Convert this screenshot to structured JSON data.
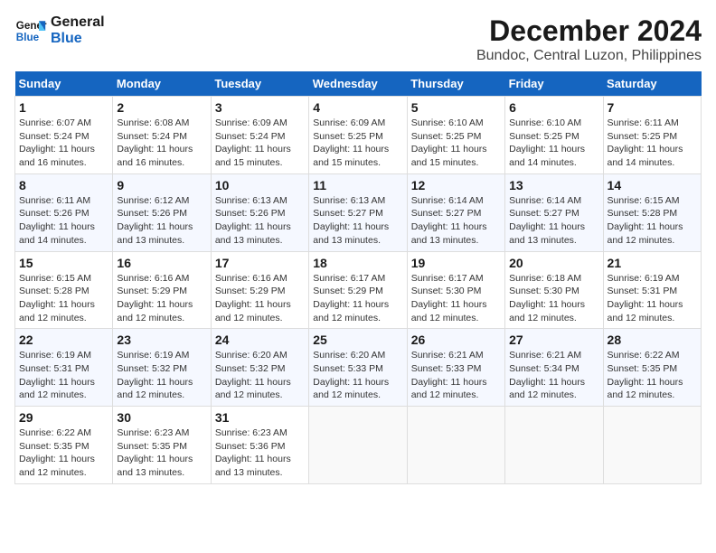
{
  "logo": {
    "line1": "General",
    "line2": "Blue"
  },
  "title": "December 2024",
  "subtitle": "Bundoc, Central Luzon, Philippines",
  "weekdays": [
    "Sunday",
    "Monday",
    "Tuesday",
    "Wednesday",
    "Thursday",
    "Friday",
    "Saturday"
  ],
  "weeks": [
    [
      {
        "day": "1",
        "sunrise": "6:07 AM",
        "sunset": "5:24 PM",
        "daylight": "11 hours and 16 minutes."
      },
      {
        "day": "2",
        "sunrise": "6:08 AM",
        "sunset": "5:24 PM",
        "daylight": "11 hours and 16 minutes."
      },
      {
        "day": "3",
        "sunrise": "6:09 AM",
        "sunset": "5:24 PM",
        "daylight": "11 hours and 15 minutes."
      },
      {
        "day": "4",
        "sunrise": "6:09 AM",
        "sunset": "5:25 PM",
        "daylight": "11 hours and 15 minutes."
      },
      {
        "day": "5",
        "sunrise": "6:10 AM",
        "sunset": "5:25 PM",
        "daylight": "11 hours and 15 minutes."
      },
      {
        "day": "6",
        "sunrise": "6:10 AM",
        "sunset": "5:25 PM",
        "daylight": "11 hours and 14 minutes."
      },
      {
        "day": "7",
        "sunrise": "6:11 AM",
        "sunset": "5:25 PM",
        "daylight": "11 hours and 14 minutes."
      }
    ],
    [
      {
        "day": "8",
        "sunrise": "6:11 AM",
        "sunset": "5:26 PM",
        "daylight": "11 hours and 14 minutes."
      },
      {
        "day": "9",
        "sunrise": "6:12 AM",
        "sunset": "5:26 PM",
        "daylight": "11 hours and 13 minutes."
      },
      {
        "day": "10",
        "sunrise": "6:13 AM",
        "sunset": "5:26 PM",
        "daylight": "11 hours and 13 minutes."
      },
      {
        "day": "11",
        "sunrise": "6:13 AM",
        "sunset": "5:27 PM",
        "daylight": "11 hours and 13 minutes."
      },
      {
        "day": "12",
        "sunrise": "6:14 AM",
        "sunset": "5:27 PM",
        "daylight": "11 hours and 13 minutes."
      },
      {
        "day": "13",
        "sunrise": "6:14 AM",
        "sunset": "5:27 PM",
        "daylight": "11 hours and 13 minutes."
      },
      {
        "day": "14",
        "sunrise": "6:15 AM",
        "sunset": "5:28 PM",
        "daylight": "11 hours and 12 minutes."
      }
    ],
    [
      {
        "day": "15",
        "sunrise": "6:15 AM",
        "sunset": "5:28 PM",
        "daylight": "11 hours and 12 minutes."
      },
      {
        "day": "16",
        "sunrise": "6:16 AM",
        "sunset": "5:29 PM",
        "daylight": "11 hours and 12 minutes."
      },
      {
        "day": "17",
        "sunrise": "6:16 AM",
        "sunset": "5:29 PM",
        "daylight": "11 hours and 12 minutes."
      },
      {
        "day": "18",
        "sunrise": "6:17 AM",
        "sunset": "5:29 PM",
        "daylight": "11 hours and 12 minutes."
      },
      {
        "day": "19",
        "sunrise": "6:17 AM",
        "sunset": "5:30 PM",
        "daylight": "11 hours and 12 minutes."
      },
      {
        "day": "20",
        "sunrise": "6:18 AM",
        "sunset": "5:30 PM",
        "daylight": "11 hours and 12 minutes."
      },
      {
        "day": "21",
        "sunrise": "6:19 AM",
        "sunset": "5:31 PM",
        "daylight": "11 hours and 12 minutes."
      }
    ],
    [
      {
        "day": "22",
        "sunrise": "6:19 AM",
        "sunset": "5:31 PM",
        "daylight": "11 hours and 12 minutes."
      },
      {
        "day": "23",
        "sunrise": "6:19 AM",
        "sunset": "5:32 PM",
        "daylight": "11 hours and 12 minutes."
      },
      {
        "day": "24",
        "sunrise": "6:20 AM",
        "sunset": "5:32 PM",
        "daylight": "11 hours and 12 minutes."
      },
      {
        "day": "25",
        "sunrise": "6:20 AM",
        "sunset": "5:33 PM",
        "daylight": "11 hours and 12 minutes."
      },
      {
        "day": "26",
        "sunrise": "6:21 AM",
        "sunset": "5:33 PM",
        "daylight": "11 hours and 12 minutes."
      },
      {
        "day": "27",
        "sunrise": "6:21 AM",
        "sunset": "5:34 PM",
        "daylight": "11 hours and 12 minutes."
      },
      {
        "day": "28",
        "sunrise": "6:22 AM",
        "sunset": "5:35 PM",
        "daylight": "11 hours and 12 minutes."
      }
    ],
    [
      {
        "day": "29",
        "sunrise": "6:22 AM",
        "sunset": "5:35 PM",
        "daylight": "11 hours and 12 minutes."
      },
      {
        "day": "30",
        "sunrise": "6:23 AM",
        "sunset": "5:35 PM",
        "daylight": "11 hours and 13 minutes."
      },
      {
        "day": "31",
        "sunrise": "6:23 AM",
        "sunset": "5:36 PM",
        "daylight": "11 hours and 13 minutes."
      },
      null,
      null,
      null,
      null
    ]
  ]
}
